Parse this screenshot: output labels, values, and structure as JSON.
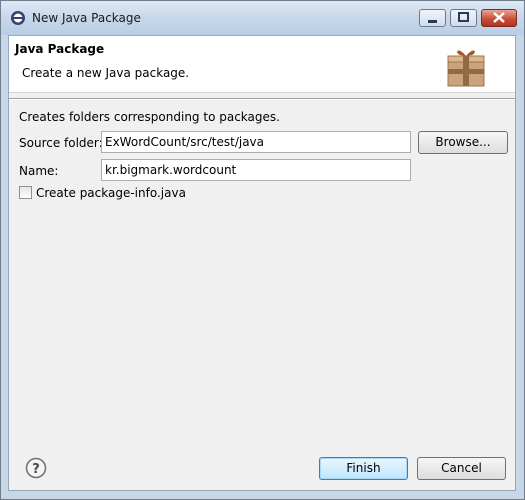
{
  "window": {
    "title": "New Java Package"
  },
  "banner": {
    "title": "Java Package",
    "description": "Create a new Java package."
  },
  "form": {
    "description": "Creates folders corresponding to packages.",
    "source_folder_label": "Source folder:",
    "source_folder_value": "ExWordCount/src/test/java",
    "browse_label": "Browse...",
    "name_label": "Name:",
    "name_value": "kr.bigmark.wordcount",
    "create_package_info_label": "Create package-info.java",
    "create_package_info_checked": false
  },
  "footer": {
    "finish_label": "Finish",
    "cancel_label": "Cancel"
  },
  "icons": {
    "app": "eclipse-icon",
    "package": "package-icon",
    "help": "help-icon",
    "minimize": "minimize-icon",
    "maximize": "maximize-icon",
    "close": "close-icon"
  }
}
